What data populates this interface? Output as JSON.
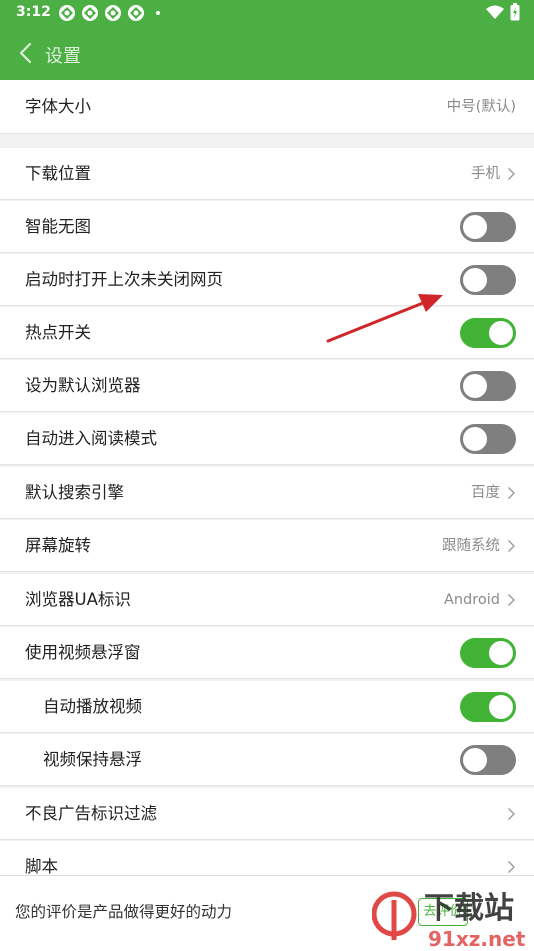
{
  "status_bar": {
    "time": "3:12",
    "icons": [
      "app-notification-icon",
      "app-notification-icon",
      "app-notification-icon",
      "app-notification-icon",
      "dot-icon"
    ],
    "right_icons": [
      "wifi-icon",
      "battery-icon"
    ]
  },
  "header": {
    "title": "设置",
    "back_icon": "chevron-left-icon"
  },
  "rows": [
    {
      "label": "字体大小",
      "value": "中号(默认)"
    },
    {
      "label": "下载位置",
      "value": "手机"
    },
    {
      "label": "智能无图",
      "toggle": "off"
    },
    {
      "label": "启动时打开上次未关闭网页",
      "toggle": "off"
    },
    {
      "label": "热点开关",
      "toggle": "on"
    },
    {
      "label": "设为默认浏览器",
      "toggle": "off"
    },
    {
      "label": "自动进入阅读模式",
      "toggle": "off"
    },
    {
      "label": "默认搜索引擎",
      "value": "百度"
    },
    {
      "label": "屏幕旋转",
      "value": "跟随系统"
    },
    {
      "label": "浏览器UA标识",
      "value": "Android"
    },
    {
      "label": "使用视频悬浮窗",
      "toggle": "on"
    },
    {
      "label": "自动播放视频",
      "toggle": "on"
    },
    {
      "label": "视频保持悬浮",
      "toggle": "off"
    },
    {
      "label": "不良广告标识过滤"
    },
    {
      "label": "脚本"
    }
  ],
  "bottom_bar": {
    "text": "您的评价是产品做得更好的动力",
    "button": "去评价"
  },
  "watermark": {
    "brand": "下载站",
    "site": "91xz.net",
    "logo_text": "9"
  },
  "colors": {
    "primary": "#4caf43",
    "toggle_on": "#43b336",
    "toggle_off": "#7f7f7f",
    "annotation_arrow": "#d0262a"
  }
}
